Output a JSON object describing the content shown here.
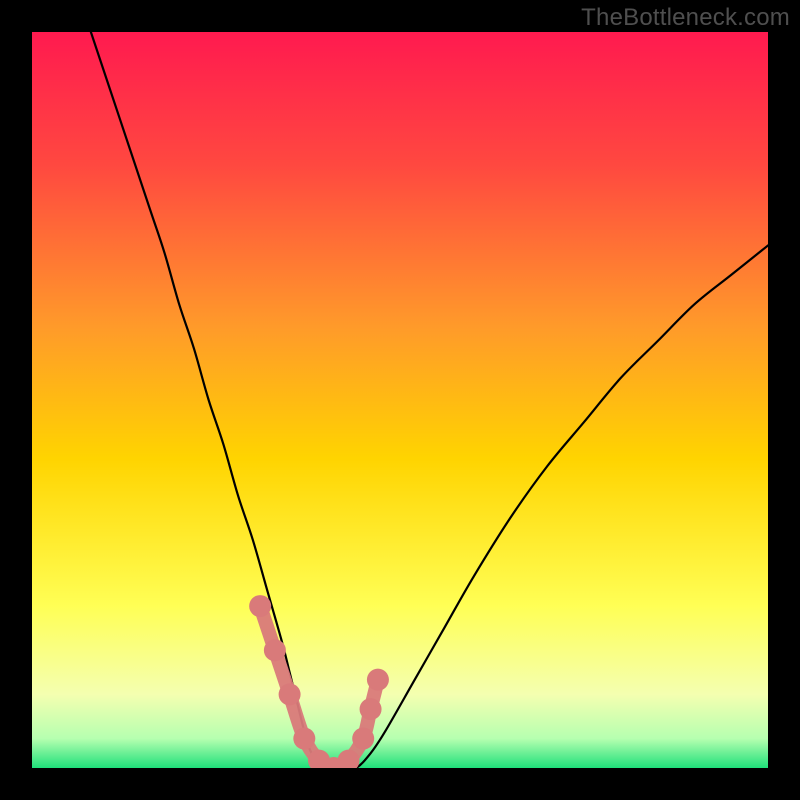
{
  "watermark": "TheBottleneck.com",
  "chart_data": {
    "type": "line",
    "title": "",
    "xlabel": "",
    "ylabel": "",
    "xlim": [
      0,
      100
    ],
    "ylim": [
      0,
      100
    ],
    "grid": false,
    "legend": false,
    "background_gradient": {
      "top": "#ff1a4f",
      "mid_upper": "#ff7a2e",
      "mid": "#ffd400",
      "mid_lower": "#ffff55",
      "near_bottom": "#f7ffb0",
      "bottom": "#1fe07a"
    },
    "series": [
      {
        "name": "curve",
        "stroke": "#000000",
        "x": [
          8,
          12,
          16,
          18,
          20,
          22,
          24,
          26,
          28,
          30,
          32,
          34,
          35,
          36,
          37,
          38,
          40,
          42,
          44,
          46,
          48,
          52,
          56,
          60,
          65,
          70,
          75,
          80,
          85,
          90,
          95,
          100
        ],
        "y": [
          100,
          88,
          76,
          70,
          63,
          57,
          50,
          44,
          37,
          31,
          24,
          17,
          13,
          9,
          5,
          2,
          0,
          0,
          0,
          2,
          5,
          12,
          19,
          26,
          34,
          41,
          47,
          53,
          58,
          63,
          67,
          71
        ]
      },
      {
        "name": "valley-markers",
        "stroke": "#d97a7a",
        "marker_fill": "#d97a7a",
        "x": [
          31,
          33,
          35,
          37,
          39,
          41,
          43,
          45,
          46,
          47
        ],
        "y": [
          22,
          16,
          10,
          4,
          1,
          0,
          1,
          4,
          8,
          12
        ]
      }
    ],
    "annotations": []
  }
}
